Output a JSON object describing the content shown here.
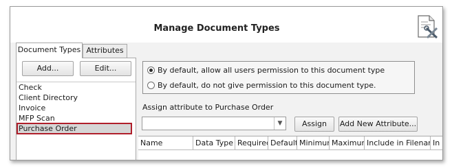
{
  "dialog": {
    "title": "Manage Document Types",
    "header_icon": "document-tools-icon"
  },
  "tabs": [
    {
      "label": "Document Types",
      "active": true
    },
    {
      "label": "Attributes",
      "active": false
    }
  ],
  "left": {
    "add_label": "Add...",
    "edit_label": "Edit...",
    "document_types": [
      "Check",
      "Client Directory",
      "Invoice",
      "MFP Scan",
      "Purchase Order"
    ],
    "selected": "Purchase Order"
  },
  "permissions": {
    "option_allow": "By default, allow all users permission to this document type",
    "option_deny": "By default, do not give permission to this document type.",
    "selected": "allow"
  },
  "assign": {
    "label": "Assign attribute to Purchase Order",
    "select_value": "",
    "assign_label": "Assign",
    "add_new_label": "Add New Attribute..."
  },
  "grid": {
    "columns": [
      "Name",
      "Data Type",
      "Required",
      "Default",
      "Minimum",
      "Maximum",
      "Include in Filename",
      "In"
    ]
  },
  "colors": {
    "selection_outline": "#b01e2a"
  }
}
